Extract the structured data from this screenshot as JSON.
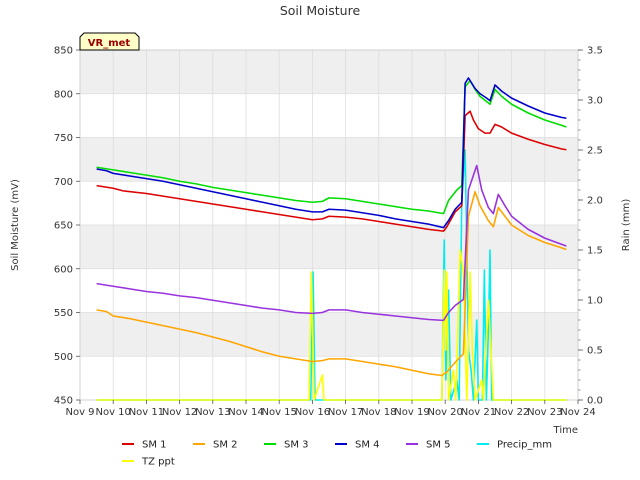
{
  "chart_data": {
    "type": "line",
    "title": "Soil Moisture",
    "badge": "VR_met",
    "xlabel": "Time",
    "ylabel": "Soil Moisture (mV)",
    "y2label": "Rain (mm)",
    "xlim": [
      9,
      24
    ],
    "ylim": [
      450,
      850
    ],
    "y2lim": [
      0,
      3.5
    ],
    "xticks": [
      {
        "x": 9,
        "label": "Nov 9"
      },
      {
        "x": 10,
        "label": "Nov 10"
      },
      {
        "x": 11,
        "label": "Nov 11"
      },
      {
        "x": 12,
        "label": "Nov 12"
      },
      {
        "x": 13,
        "label": "Nov 13"
      },
      {
        "x": 14,
        "label": "Nov 14"
      },
      {
        "x": 15,
        "label": "Nov 15"
      },
      {
        "x": 16,
        "label": "Nov 16"
      },
      {
        "x": 17,
        "label": "Nov 17"
      },
      {
        "x": 18,
        "label": "Nov 18"
      },
      {
        "x": 19,
        "label": "Nov 19"
      },
      {
        "x": 20,
        "label": "Nov 20"
      },
      {
        "x": 21,
        "label": "Nov 21"
      },
      {
        "x": 22,
        "label": "Nov 22"
      },
      {
        "x": 23,
        "label": "Nov 23"
      },
      {
        "x": 24,
        "label": "Nov 24"
      }
    ],
    "yticks": [
      450,
      500,
      550,
      600,
      650,
      700,
      750,
      800,
      850
    ],
    "y2ticks": [
      "0.0",
      "0.5",
      "1.0",
      "1.5",
      "2.0",
      "2.5",
      "3.0",
      "3.5"
    ],
    "grid": true,
    "legend_position": "bottom",
    "series": [
      {
        "name": "SM 1",
        "axis": "left",
        "color": "#dd0000",
        "points": [
          [
            9.5,
            695
          ],
          [
            10,
            692
          ],
          [
            10.3,
            689
          ],
          [
            11,
            686
          ],
          [
            11.5,
            683
          ],
          [
            12,
            680
          ],
          [
            12.5,
            677
          ],
          [
            13,
            674
          ],
          [
            13.5,
            671
          ],
          [
            14,
            668
          ],
          [
            14.5,
            665
          ],
          [
            15,
            662
          ],
          [
            15.5,
            659
          ],
          [
            16,
            656
          ],
          [
            16.3,
            657
          ],
          [
            16.5,
            660
          ],
          [
            17,
            659
          ],
          [
            17.5,
            657
          ],
          [
            18,
            654
          ],
          [
            18.5,
            651
          ],
          [
            19,
            648
          ],
          [
            19.5,
            645
          ],
          [
            19.95,
            643
          ],
          [
            20.05,
            648
          ],
          [
            20.3,
            665
          ],
          [
            20.5,
            672
          ],
          [
            20.6,
            775
          ],
          [
            20.75,
            780
          ],
          [
            20.85,
            770
          ],
          [
            21,
            760
          ],
          [
            21.2,
            755
          ],
          [
            21.35,
            755
          ],
          [
            21.5,
            765
          ],
          [
            21.7,
            762
          ],
          [
            22,
            755
          ],
          [
            22.5,
            748
          ],
          [
            23,
            742
          ],
          [
            23.5,
            737
          ],
          [
            23.65,
            736
          ]
        ]
      },
      {
        "name": "SM 2",
        "axis": "left",
        "color": "#ffa500",
        "points": [
          [
            9.5,
            553
          ],
          [
            9.8,
            551
          ],
          [
            10,
            546
          ],
          [
            10.5,
            543
          ],
          [
            11,
            539
          ],
          [
            11.5,
            535
          ],
          [
            12,
            531
          ],
          [
            12.5,
            527
          ],
          [
            13,
            522
          ],
          [
            13.5,
            517
          ],
          [
            14,
            511
          ],
          [
            14.5,
            505
          ],
          [
            15,
            500
          ],
          [
            15.5,
            497
          ],
          [
            16,
            494
          ],
          [
            16.3,
            495
          ],
          [
            16.5,
            497
          ],
          [
            17,
            497
          ],
          [
            17.5,
            494
          ],
          [
            18,
            491
          ],
          [
            18.5,
            488
          ],
          [
            19,
            484
          ],
          [
            19.5,
            480
          ],
          [
            19.9,
            478
          ],
          [
            20.05,
            482
          ],
          [
            20.3,
            493
          ],
          [
            20.55,
            503
          ],
          [
            20.7,
            660
          ],
          [
            20.9,
            688
          ],
          [
            21.05,
            672
          ],
          [
            21.3,
            655
          ],
          [
            21.45,
            648
          ],
          [
            21.6,
            670
          ],
          [
            21.8,
            660
          ],
          [
            22,
            650
          ],
          [
            22.5,
            638
          ],
          [
            23,
            630
          ],
          [
            23.5,
            624
          ],
          [
            23.65,
            622
          ]
        ]
      },
      {
        "name": "SM 3",
        "axis": "left",
        "color": "#00dd00",
        "points": [
          [
            9.5,
            716
          ],
          [
            10,
            713
          ],
          [
            10.5,
            710
          ],
          [
            11,
            707
          ],
          [
            11.5,
            704
          ],
          [
            12,
            700
          ],
          [
            12.5,
            697
          ],
          [
            13,
            693
          ],
          [
            13.5,
            690
          ],
          [
            14,
            687
          ],
          [
            14.5,
            684
          ],
          [
            15,
            681
          ],
          [
            15.5,
            678
          ],
          [
            16,
            676
          ],
          [
            16.3,
            677
          ],
          [
            16.5,
            681
          ],
          [
            17,
            680
          ],
          [
            17.5,
            677
          ],
          [
            18,
            674
          ],
          [
            18.5,
            671
          ],
          [
            19,
            668
          ],
          [
            19.5,
            666
          ],
          [
            19.95,
            663
          ],
          [
            20.1,
            678
          ],
          [
            20.35,
            690
          ],
          [
            20.5,
            695
          ],
          [
            20.6,
            808
          ],
          [
            20.75,
            815
          ],
          [
            20.9,
            805
          ],
          [
            21.05,
            797
          ],
          [
            21.25,
            791
          ],
          [
            21.35,
            788
          ],
          [
            21.5,
            805
          ],
          [
            21.7,
            797
          ],
          [
            22,
            788
          ],
          [
            22.5,
            778
          ],
          [
            23,
            770
          ],
          [
            23.5,
            764
          ],
          [
            23.65,
            762
          ]
        ]
      },
      {
        "name": "SM 4",
        "axis": "left",
        "color": "#0000cc",
        "points": [
          [
            9.5,
            714
          ],
          [
            9.8,
            712
          ],
          [
            10,
            709
          ],
          [
            10.5,
            706
          ],
          [
            11,
            703
          ],
          [
            11.5,
            700
          ],
          [
            12,
            696
          ],
          [
            12.5,
            692
          ],
          [
            13,
            688
          ],
          [
            13.5,
            684
          ],
          [
            14,
            680
          ],
          [
            14.5,
            676
          ],
          [
            15,
            672
          ],
          [
            15.5,
            668
          ],
          [
            16,
            665
          ],
          [
            16.3,
            665
          ],
          [
            16.5,
            668
          ],
          [
            17,
            667
          ],
          [
            17.5,
            664
          ],
          [
            18,
            661
          ],
          [
            18.5,
            657
          ],
          [
            19,
            654
          ],
          [
            19.5,
            651
          ],
          [
            19.95,
            647
          ],
          [
            20.1,
            655
          ],
          [
            20.3,
            668
          ],
          [
            20.5,
            676
          ],
          [
            20.6,
            812
          ],
          [
            20.7,
            818
          ],
          [
            20.9,
            806
          ],
          [
            21.05,
            800
          ],
          [
            21.25,
            795
          ],
          [
            21.35,
            792
          ],
          [
            21.5,
            810
          ],
          [
            21.7,
            803
          ],
          [
            22,
            795
          ],
          [
            22.5,
            786
          ],
          [
            23,
            778
          ],
          [
            23.5,
            773
          ],
          [
            23.65,
            772
          ]
        ]
      },
      {
        "name": "SM 5",
        "axis": "left",
        "color": "#9933dd",
        "points": [
          [
            9.5,
            583
          ],
          [
            10,
            580
          ],
          [
            10.5,
            577
          ],
          [
            11,
            574
          ],
          [
            11.5,
            572
          ],
          [
            12,
            569
          ],
          [
            12.5,
            567
          ],
          [
            13,
            564
          ],
          [
            13.5,
            561
          ],
          [
            14,
            558
          ],
          [
            14.5,
            555
          ],
          [
            15,
            553
          ],
          [
            15.5,
            550
          ],
          [
            16,
            549
          ],
          [
            16.3,
            550
          ],
          [
            16.5,
            553
          ],
          [
            17,
            553
          ],
          [
            17.5,
            550
          ],
          [
            18,
            548
          ],
          [
            18.5,
            546
          ],
          [
            19,
            544
          ],
          [
            19.5,
            542
          ],
          [
            19.95,
            541
          ],
          [
            20.1,
            550
          ],
          [
            20.3,
            558
          ],
          [
            20.55,
            565
          ],
          [
            20.7,
            690
          ],
          [
            20.95,
            718
          ],
          [
            21.1,
            690
          ],
          [
            21.3,
            670
          ],
          [
            21.45,
            663
          ],
          [
            21.6,
            685
          ],
          [
            21.8,
            672
          ],
          [
            22,
            660
          ],
          [
            22.5,
            645
          ],
          [
            23,
            635
          ],
          [
            23.5,
            628
          ],
          [
            23.65,
            626
          ]
        ]
      },
      {
        "name": "Precip_mm",
        "axis": "right",
        "color": "#00eeee",
        "points": [
          [
            9.5,
            0
          ],
          [
            15.95,
            0
          ],
          [
            16.02,
            1.28
          ],
          [
            16.08,
            0
          ],
          [
            19.9,
            0
          ],
          [
            19.97,
            1.6
          ],
          [
            20.02,
            0.2
          ],
          [
            20.1,
            1.1
          ],
          [
            20.17,
            0
          ],
          [
            20.35,
            0.2
          ],
          [
            20.42,
            0
          ],
          [
            20.5,
            2.0
          ],
          [
            20.6,
            2.5
          ],
          [
            20.7,
            0.5
          ],
          [
            20.78,
            0.3
          ],
          [
            20.85,
            0
          ],
          [
            20.95,
            0.8
          ],
          [
            21.0,
            0
          ],
          [
            21.12,
            0
          ],
          [
            21.18,
            1.3
          ],
          [
            21.24,
            0
          ],
          [
            21.3,
            0.7
          ],
          [
            21.35,
            1.5
          ],
          [
            21.4,
            0
          ],
          [
            23.65,
            0
          ]
        ]
      },
      {
        "name": "TZ ppt",
        "axis": "right",
        "color": "#ffff00",
        "points": [
          [
            9.5,
            0
          ],
          [
            15.9,
            0
          ],
          [
            15.97,
            1.28
          ],
          [
            16.05,
            0
          ],
          [
            16.3,
            0.25
          ],
          [
            16.35,
            0
          ],
          [
            19.9,
            0
          ],
          [
            19.97,
            1.3
          ],
          [
            20.02,
            0.5
          ],
          [
            20.05,
            1.28
          ],
          [
            20.1,
            0
          ],
          [
            20.25,
            0.3
          ],
          [
            20.32,
            0
          ],
          [
            20.45,
            1.5
          ],
          [
            20.55,
            1.28
          ],
          [
            20.65,
            0
          ],
          [
            20.75,
            1.28
          ],
          [
            20.82,
            0.5
          ],
          [
            20.9,
            0
          ],
          [
            21.1,
            0.2
          ],
          [
            21.15,
            0
          ],
          [
            21.3,
            1.0
          ],
          [
            21.38,
            0.5
          ],
          [
            21.45,
            0
          ],
          [
            23.65,
            0
          ]
        ]
      }
    ]
  }
}
